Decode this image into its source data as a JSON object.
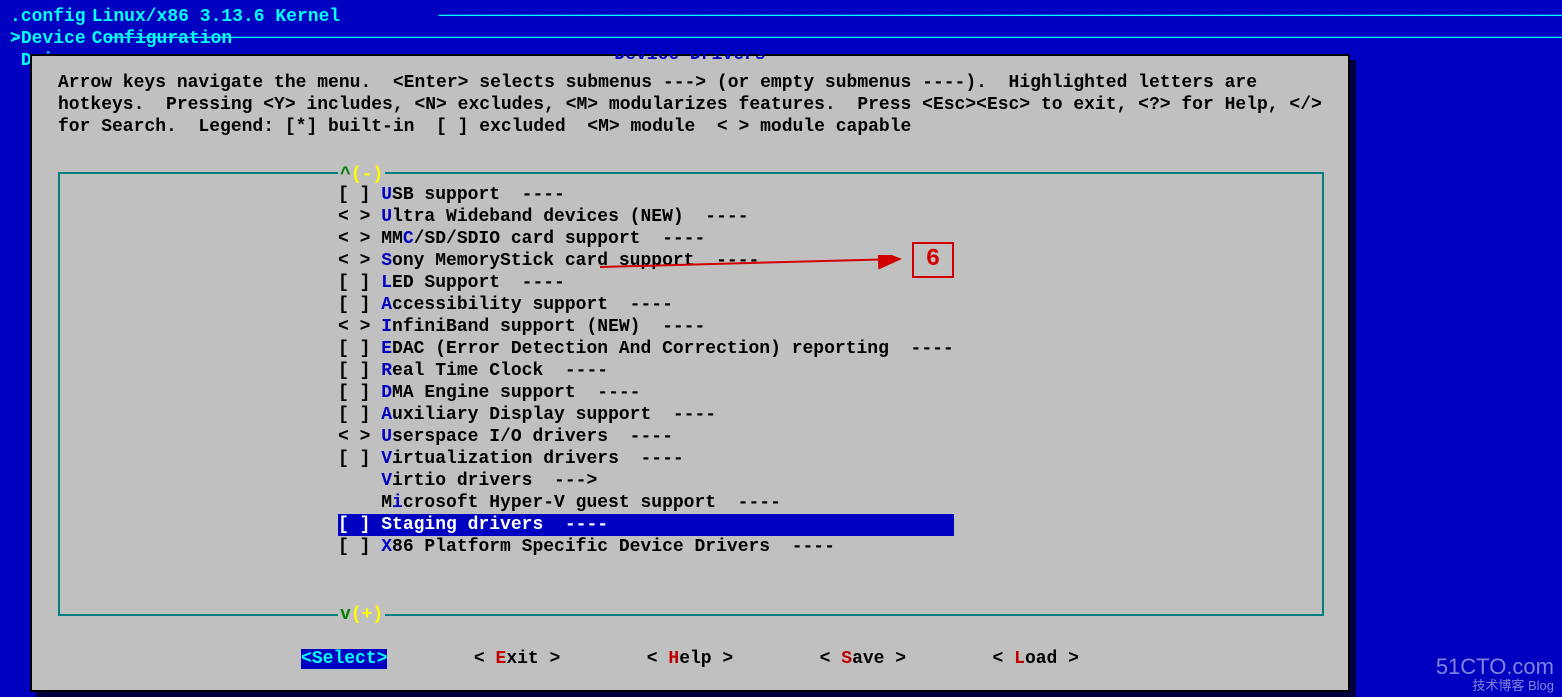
{
  "header": {
    "title_prefix": ".config - ",
    "title": "Linux/x86 3.13.6 Kernel Configuration",
    "breadcrumb_prefix": "> ",
    "breadcrumb": "Device Drivers"
  },
  "dialog": {
    "title": "Device Drivers",
    "help": "Arrow keys navigate the menu.  <Enter> selects submenus ---> (or empty submenus ----).  Highlighted letters are hotkeys.  Pressing <Y> includes, <N> excludes, <M> modularizes features.  Press <Esc><Esc> to exit, <?> for Help, </> for Search.  Legend: [*] built-in  [ ] excluded  <M> module  < > module capable"
  },
  "scroll": {
    "up": "^(-)",
    "down": "v(+)"
  },
  "menu": {
    "items": [
      {
        "prefix": "[ ] ",
        "hk": "U",
        "rest": "SB support  ----",
        "selected": false
      },
      {
        "prefix": "< > ",
        "hk": "U",
        "rest": "ltra Wideband devices (NEW)  ----",
        "selected": false
      },
      {
        "prefix": "< > MM",
        "hk": "C",
        "rest": "/SD/SDIO card support  ----",
        "selected": false
      },
      {
        "prefix": "< > ",
        "hk": "S",
        "rest": "ony MemoryStick card support  ----",
        "selected": false
      },
      {
        "prefix": "[ ] ",
        "hk": "L",
        "rest": "ED Support  ----",
        "selected": false
      },
      {
        "prefix": "[ ] ",
        "hk": "A",
        "rest": "ccessibility support  ----",
        "selected": false
      },
      {
        "prefix": "< > ",
        "hk": "I",
        "rest": "nfiniBand support (NEW)  ----",
        "selected": false
      },
      {
        "prefix": "[ ] ",
        "hk": "E",
        "rest": "DAC (Error Detection And Correction) reporting  ----",
        "selected": false
      },
      {
        "prefix": "[ ] ",
        "hk": "R",
        "rest": "eal Time Clock  ----",
        "selected": false
      },
      {
        "prefix": "[ ] ",
        "hk": "D",
        "rest": "MA Engine support  ----",
        "selected": false
      },
      {
        "prefix": "[ ] ",
        "hk": "A",
        "rest": "uxiliary Display support  ----",
        "selected": false
      },
      {
        "prefix": "< > ",
        "hk": "U",
        "rest": "serspace I/O drivers  ----",
        "selected": false
      },
      {
        "prefix": "[ ] ",
        "hk": "V",
        "rest": "irtualization drivers  ----",
        "selected": false
      },
      {
        "prefix": "    ",
        "hk": "V",
        "rest": "irtio drivers  --->",
        "selected": false
      },
      {
        "prefix": "    M",
        "hk": "i",
        "rest": "crosoft Hyper-V guest support  ----",
        "selected": false
      },
      {
        "prefix": "[ ] ",
        "hk": "S",
        "rest": "taging drivers  ----",
        "selected": true
      },
      {
        "prefix": "[ ] ",
        "hk": "X",
        "rest": "86 Platform Specific Device Drivers  ----",
        "selected": false
      }
    ]
  },
  "buttons": {
    "select": {
      "open": "<",
      "hk": "S",
      "rest": "elect",
      "close": ">",
      "selected": true
    },
    "exit": {
      "open": "< ",
      "hk": "E",
      "rest": "xit ",
      "close": ">",
      "selected": false
    },
    "help": {
      "open": "< ",
      "hk": "H",
      "rest": "elp ",
      "close": ">",
      "selected": false
    },
    "save": {
      "open": "< ",
      "hk": "S",
      "rest": "ave ",
      "close": ">",
      "selected": false
    },
    "load": {
      "open": "< ",
      "hk": "L",
      "rest": "oad ",
      "close": ">",
      "selected": false
    }
  },
  "callout": {
    "number": "6"
  },
  "watermark": {
    "line1": "51CTO.com",
    "line2": "技术博客  Blog"
  }
}
